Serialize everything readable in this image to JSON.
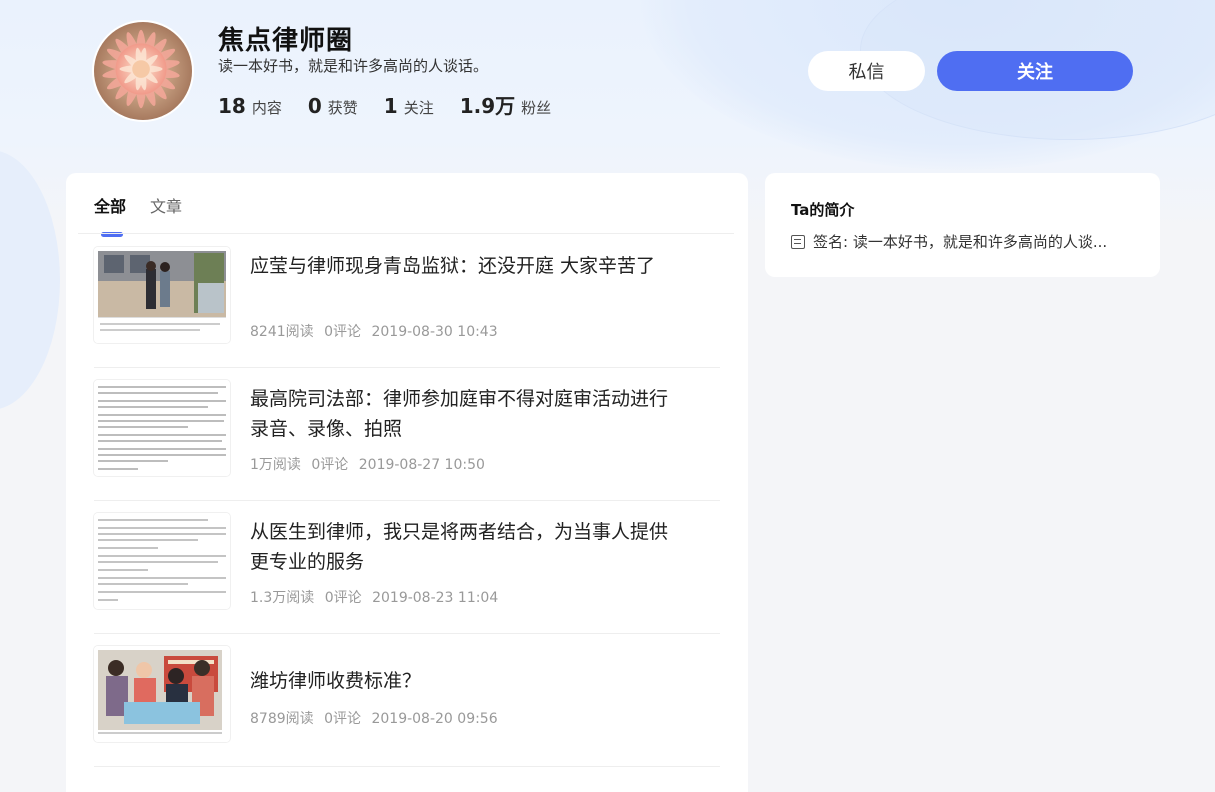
{
  "profile": {
    "name": "焦点律师圈",
    "bio": "读一本好书，就是和许多高尚的人谈话。",
    "stats": [
      {
        "num": "18",
        "label": "内容"
      },
      {
        "num": "0",
        "label": "获赞"
      },
      {
        "num": "1",
        "label": "关注"
      },
      {
        "num": "1.9万",
        "label": "粉丝"
      }
    ],
    "message_label": "私信",
    "follow_label": "关注"
  },
  "tabs": [
    "全部",
    "文章"
  ],
  "articles": [
    {
      "title": "应莹与律师现身青岛监狱：还没开庭 大家辛苦了",
      "reads": "8241阅读",
      "comments": "0评论",
      "date": "2019-08-30 10:43"
    },
    {
      "title": "最高院司法部：律师参加庭审不得对庭审活动进行录音、录像、拍照",
      "reads": "1万阅读",
      "comments": "0评论",
      "date": "2019-08-27 10:50"
    },
    {
      "title": "从医生到律师，我只是将两者结合，为当事人提供更专业的服务",
      "reads": "1.3万阅读",
      "comments": "0评论",
      "date": "2019-08-23 11:04"
    },
    {
      "title": "潍坊律师收费标准？",
      "reads": "8789阅读",
      "comments": "0评论",
      "date": "2019-08-20 09:56"
    }
  ],
  "side": {
    "title": "Ta的简介",
    "signature": "签名: 读一本好书，就是和许多高尚的人谈..."
  },
  "colors": {
    "accent": "#4f6ef2"
  }
}
